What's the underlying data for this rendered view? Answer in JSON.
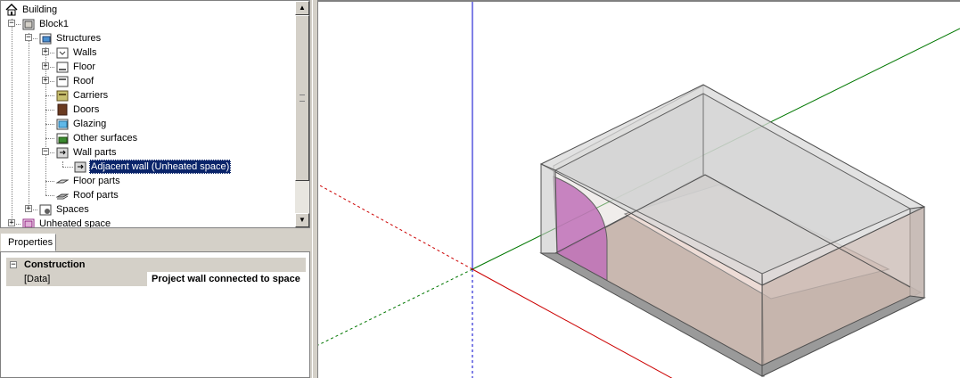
{
  "tree": {
    "items": [
      {
        "label": "Building",
        "icon": "building-icon"
      },
      {
        "label": "Block1",
        "icon": "block-icon"
      },
      {
        "label": "Structures",
        "icon": "structures-icon"
      },
      {
        "label": "Walls",
        "icon": "walls-icon"
      },
      {
        "label": "Floor",
        "icon": "floor-icon"
      },
      {
        "label": "Roof",
        "icon": "roof-icon"
      },
      {
        "label": "Carriers",
        "icon": "carriers-icon"
      },
      {
        "label": "Doors",
        "icon": "door-icon"
      },
      {
        "label": "Glazing",
        "icon": "glazing-icon"
      },
      {
        "label": "Other surfaces",
        "icon": "other-surfaces-icon"
      },
      {
        "label": "Wall parts",
        "icon": "wall-parts-icon"
      },
      {
        "label": "Adjacent wall (Unheated space)",
        "icon": "adjacent-wall-icon",
        "selected": true
      },
      {
        "label": "Floor parts",
        "icon": "floor-parts-icon"
      },
      {
        "label": "Roof parts",
        "icon": "roof-parts-icon"
      },
      {
        "label": "Spaces",
        "icon": "spaces-icon"
      },
      {
        "label": "Unheated space",
        "icon": "unheated-space-icon"
      }
    ]
  },
  "properties": {
    "tab_label": "Properties",
    "category": "Construction",
    "rows": [
      {
        "name": "[Data]",
        "value": "Project wall connected to space"
      }
    ]
  },
  "viewport": {
    "axis_colors": {
      "x": "#cc0000",
      "y": "#007700",
      "z": "#0000cc"
    },
    "box_fill": "#d8d8d8",
    "floor_fill": "#c9b8b0",
    "selected_wall_fill": "#c070b8"
  }
}
